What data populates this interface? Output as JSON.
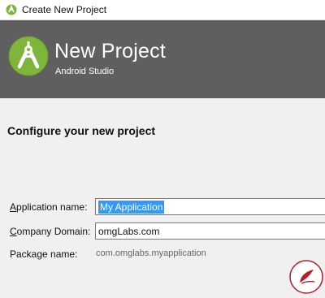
{
  "window": {
    "title": "Create New Project"
  },
  "banner": {
    "heading": "New Project",
    "subheading": "Android Studio"
  },
  "form": {
    "section_title": "Configure your new project",
    "application_name": {
      "label_prefix": "",
      "label_accel": "A",
      "label_rest": "pplication name:",
      "value": "My Application"
    },
    "company_domain": {
      "label_prefix": "",
      "label_accel": "C",
      "label_rest": "ompany Domain:",
      "value": "omgLabs.com"
    },
    "package_name": {
      "label": "Package name:",
      "value": "com.omglabs.myapplication"
    }
  },
  "colors": {
    "banner_bg": "#5f5f5f",
    "logo_green": "#80b53c",
    "selection": "#3399ff"
  },
  "icons": {
    "window_icon": "android-studio-icon",
    "logo": "android-studio-logo",
    "watermark": "watermark-logo"
  }
}
